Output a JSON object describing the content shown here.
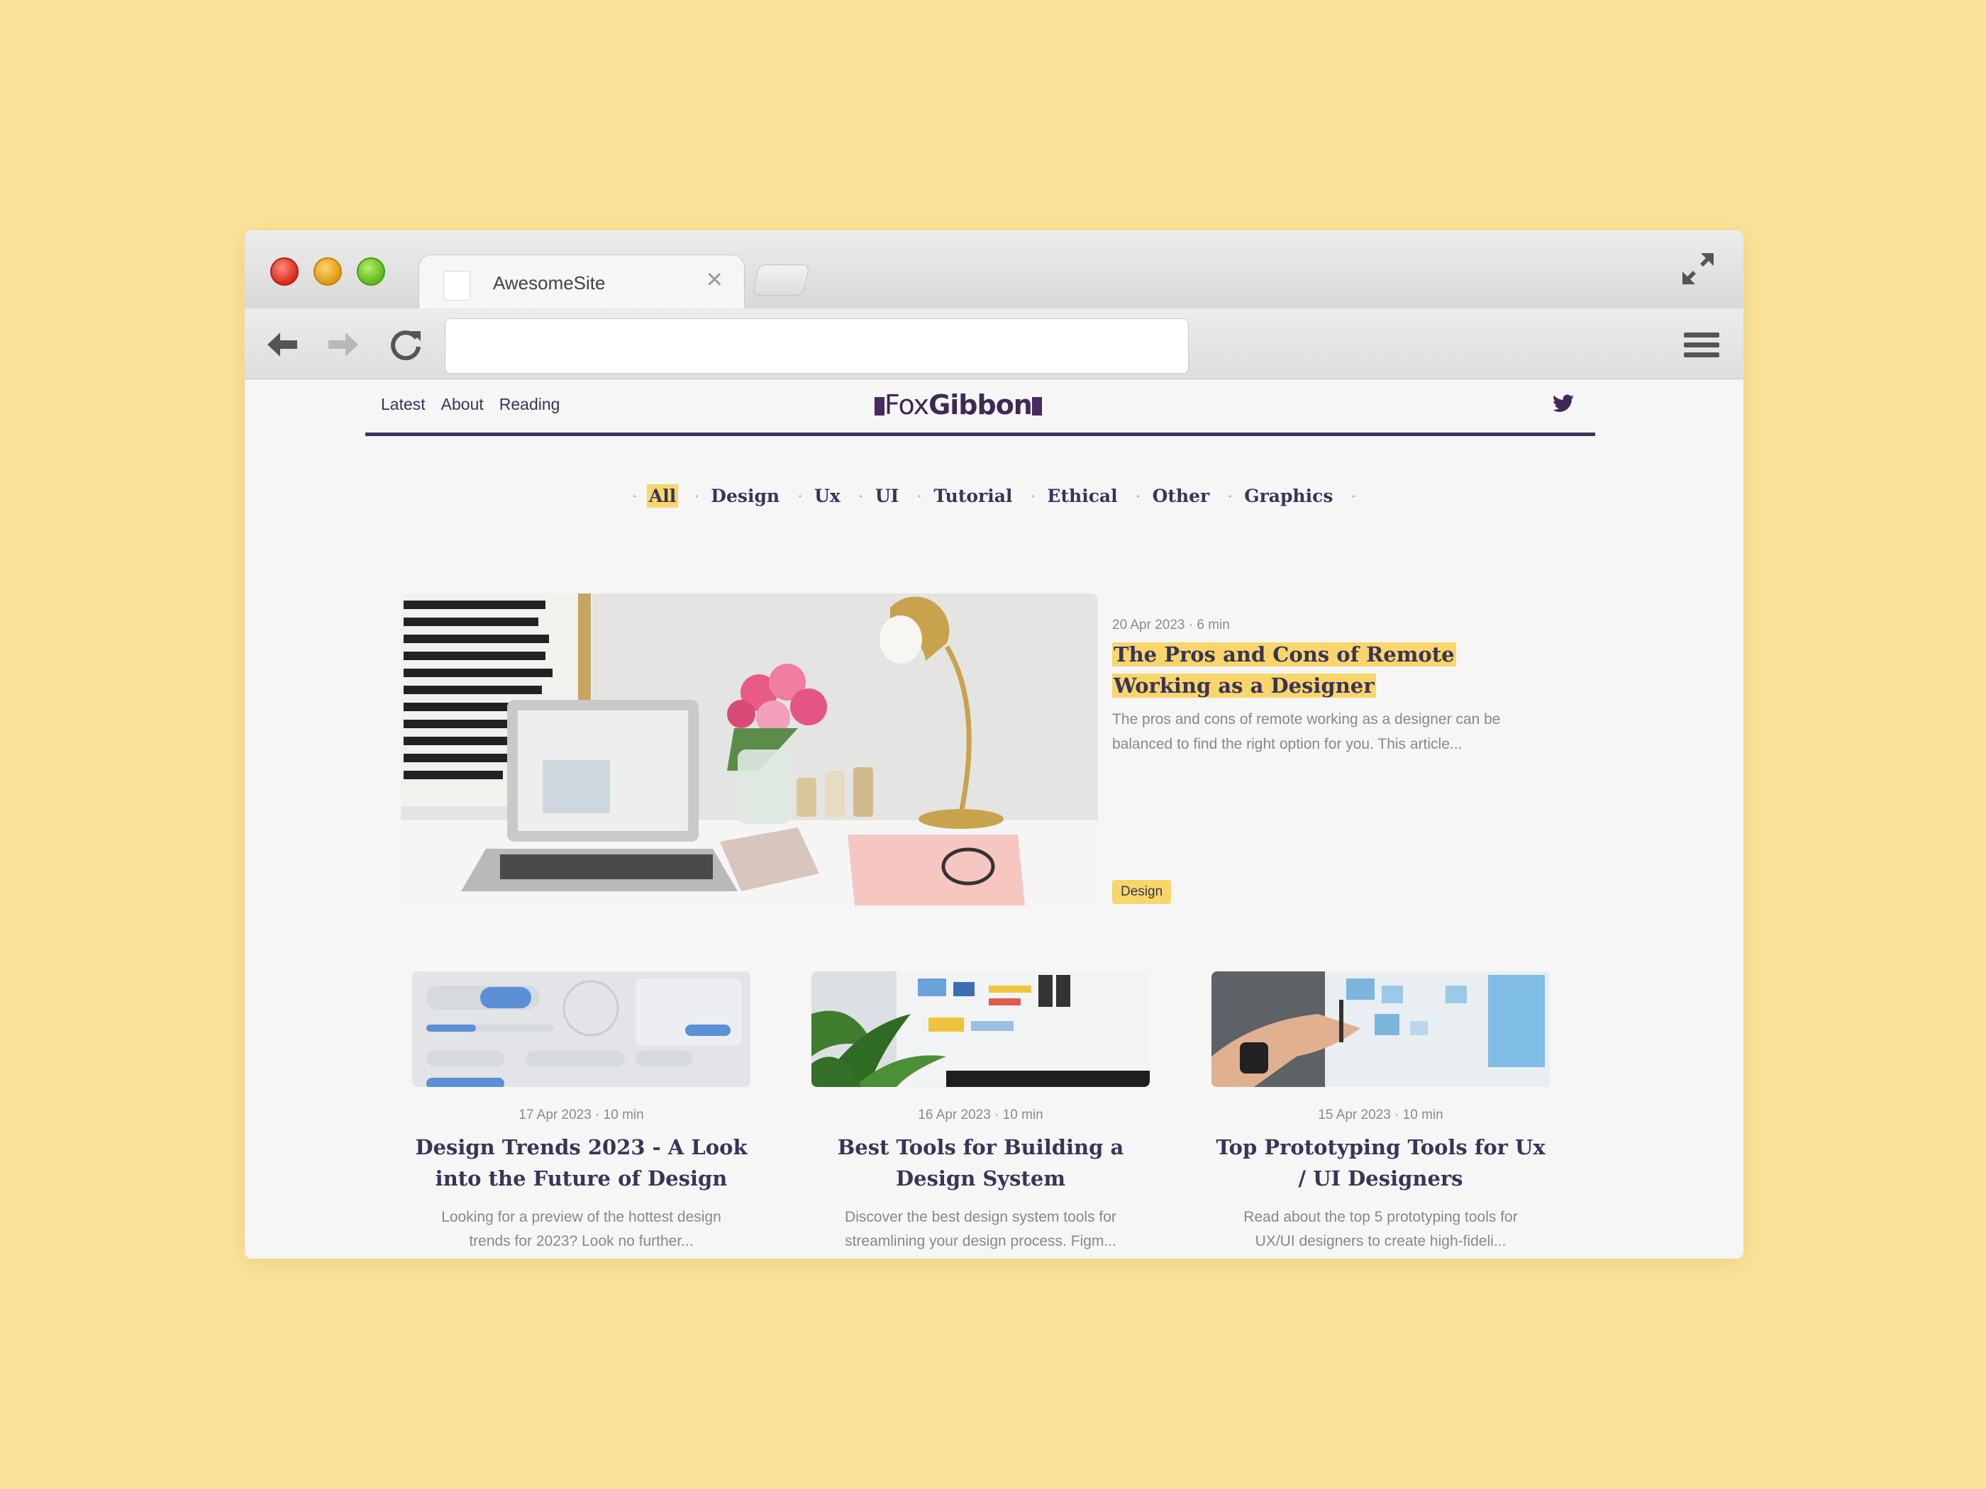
{
  "browser": {
    "tab_title": "AwesomeSite",
    "url": ""
  },
  "site": {
    "nav": [
      "Latest",
      "About",
      "Reading"
    ],
    "logo_text_1": "Fox",
    "logo_text_2": "Gibbon"
  },
  "categories": [
    "All",
    "Design",
    "Ux",
    "UI",
    "Tutorial",
    "Ethical",
    "Other",
    "Graphics"
  ],
  "featured": {
    "meta": "20 Apr 2023 · 6 min",
    "title": "The Pros and Cons of Remote Working as a Designer",
    "description": "The pros and cons of remote working as a designer can be balanced to find the right option for you. This article...",
    "tag": "Design"
  },
  "cards": [
    {
      "meta": "17 Apr 2023 · 10 min",
      "title": "Design Trends 2023 - A Look into the Future of Design",
      "description": "Looking for a preview of the hottest design trends for 2023? Look no further..."
    },
    {
      "meta": "16 Apr 2023 · 10 min",
      "title": "Best Tools for Building a Design System",
      "description": "Discover the best design system tools for streamlining your design process. Figm..."
    },
    {
      "meta": "15 Apr 2023 · 10 min",
      "title": "Top Prototyping Tools for Ux / UI Designers",
      "description": "Read about the top 5 prototyping tools for UX/UI designers to create high-fideli..."
    }
  ],
  "colors": {
    "background": "#f9e398",
    "accent": "#f8d66b",
    "brand": "#3a3459"
  },
  "icons": [
    "back-arrow-icon",
    "forward-arrow-icon",
    "reload-icon",
    "hamburger-menu-icon",
    "expand-icon",
    "twitter-icon",
    "close-icon"
  ]
}
